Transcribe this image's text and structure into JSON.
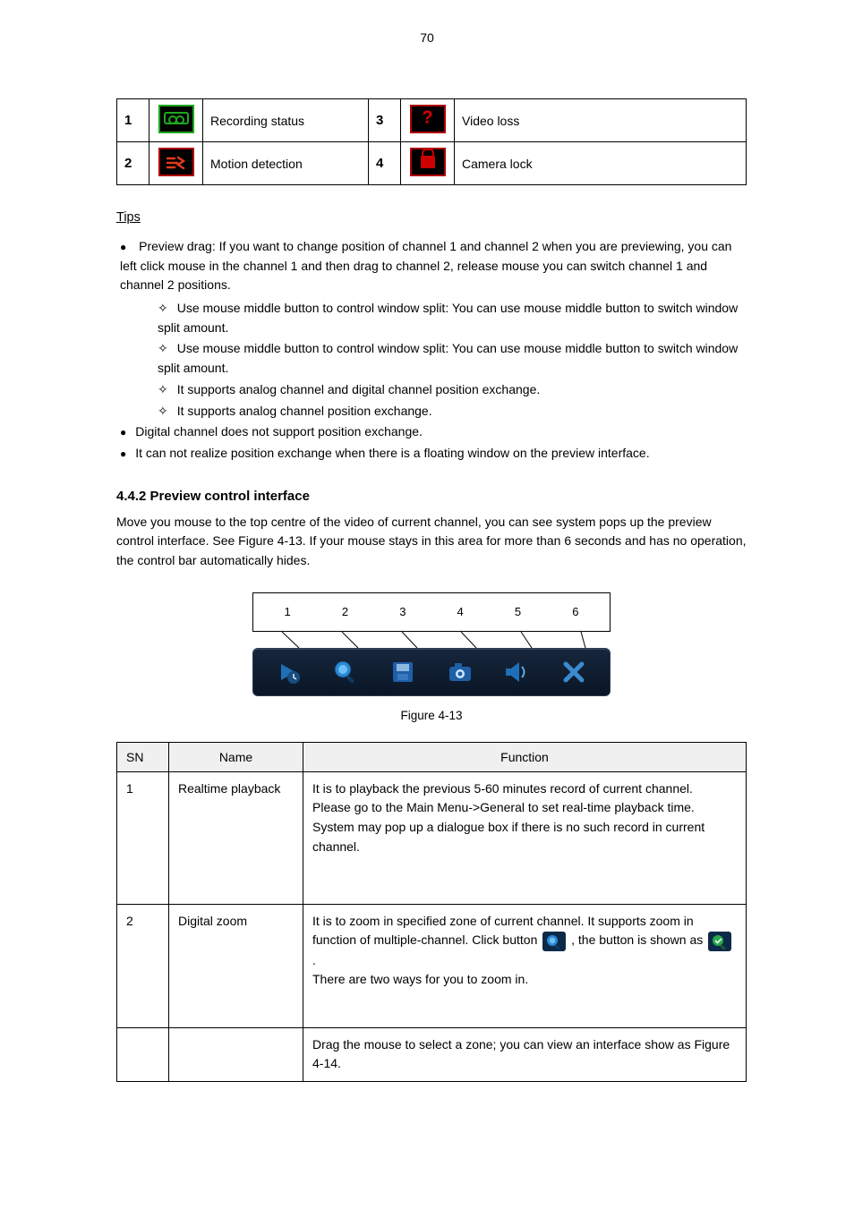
{
  "page_number": "70",
  "table1": {
    "rows": [
      {
        "n": "1",
        "desc": "Recording status",
        "n2": "3",
        "desc2": "Video loss"
      },
      {
        "n": "2",
        "desc": "Motion detection",
        "n2": "4",
        "desc2": "Camera lock"
      }
    ]
  },
  "tips": {
    "heading": "Tips",
    "top": [
      {
        "text": "Preview drag: If you want to change position of channel 1 and channel 2 when you are previewing, you can left click mouse in the channel 1 and then drag to channel 2, release mouse you can switch channel 1 and channel 2 positions.",
        "sub": [
          "Use mouse middle button to control window split: You can use mouse middle button to switch window split amount.",
          "Use mouse middle button to control window split: You can use mouse middle button to switch window split amount.",
          "It supports analog channel and digital channel position exchange.",
          "It supports analog channel position exchange."
        ]
      },
      {
        "text": "Digital channel does not support position exchange."
      },
      {
        "text": "It can not realize position exchange when there is a floating window on the preview interface."
      }
    ]
  },
  "section": {
    "heading": "4.4.2 Preview control interface",
    "para": "Move you mouse to the top centre of the video of current channel, you can see system pops up the preview control interface. See Figure 4-13. If your mouse stays in this area for more than 6 seconds and has no operation, the control bar automatically hides.",
    "figure_labels": [
      "1",
      "2",
      "3",
      "4",
      "5",
      "6"
    ],
    "figure_caption": "Figure 4-13"
  },
  "table2": {
    "headers": [
      "SN",
      "Name",
      "Function"
    ],
    "rows": [
      {
        "sn": "1",
        "name": "Realtime playback",
        "func": "It is to playback the previous 5-60 minutes record of current channel.\nPlease go to the Main Menu->General to set real-time playback time.\nSystem may pop up a dialogue box if there is no such record in current channel."
      },
      {
        "sn": "2",
        "name": "Digital zoom",
        "func_pre": "It is to zoom in specified zone of current channel. It supports zoom in function of multiple-channel.\nClick button ",
        "func_mid": ", the button is shown as ",
        "func_post": ".\nThere are two ways for you to zoom in."
      },
      {
        "sn": "",
        "name": "",
        "func": "Drag the mouse to select a zone; you can view an interface show as Figure 4-14."
      }
    ]
  }
}
